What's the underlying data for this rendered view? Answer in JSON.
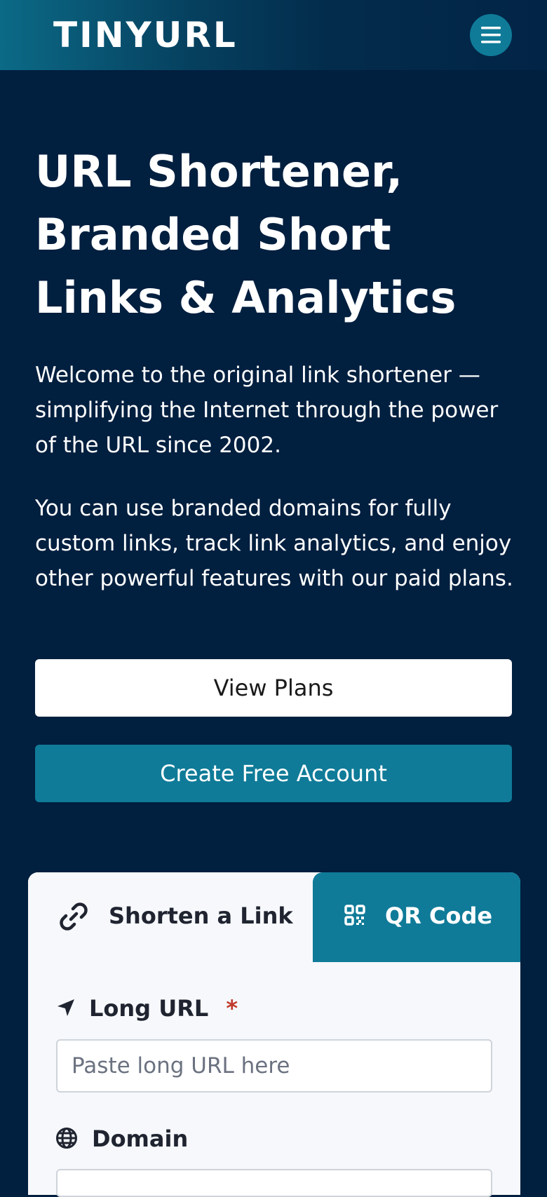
{
  "header": {
    "logo_text": "TINYURL",
    "menu_icon": "hamburger-menu-icon"
  },
  "hero": {
    "title": "URL Shortener, Branded Short Links & Analytics",
    "paragraph1": "Welcome to the original link shortener — simplifying the Internet through the power of the URL since 2002.",
    "paragraph2": "You can use branded domains for fully custom links, track link analytics, and enjoy other powerful features with our paid plans."
  },
  "buttons": {
    "view_plans": "View Plans",
    "create_account": "Create Free Account"
  },
  "tabs": {
    "shorten_label": "Shorten a Link",
    "shorten_icon": "link-icon",
    "qr_label": "QR Code",
    "qr_icon": "qr-code-icon"
  },
  "form": {
    "long_url_label": "Long URL",
    "required_mark": "*",
    "long_url_placeholder": "Paste long URL here",
    "long_url_value": "",
    "domain_label": "Domain"
  },
  "colors": {
    "background": "#011f3f",
    "accent": "#0f7b98",
    "card": "#f6f8fb",
    "required": "#c0392b"
  }
}
